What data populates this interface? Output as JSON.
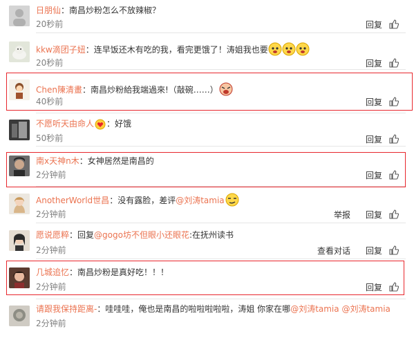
{
  "comments": [
    {
      "user": "日朋仙",
      "sep": "：",
      "text": "南昌炒粉怎么不放辣椒？",
      "time": "20秒前",
      "reply": "回复"
    },
    {
      "user": "kkw滴团子妞",
      "sep": "：",
      "text": "连早饭还木有吃的我，看完更饿了！涛姐我也要",
      "time": "20秒前",
      "reply": "回复"
    },
    {
      "user": "Chen陳清畫",
      "sep": "：",
      "text": "南昌炒粉給我端過來!（敲碗……）",
      "time": "40秒前",
      "reply": "回复"
    },
    {
      "user": "不愿听天由命人",
      "sep": "：",
      "text": "好饿",
      "time": "50秒前",
      "reply": "回复"
    },
    {
      "user": "南x天神n木",
      "sep": "：",
      "text": "女神居然是南昌的",
      "time": "2分钟前",
      "reply": "回复"
    },
    {
      "user": "AnotherWorld世昌",
      "sep": "：",
      "text": "没有露脸，差评",
      "mention": "@刘涛tamia",
      "time": "2分钟前",
      "report": "举报",
      "reply": "回复"
    },
    {
      "user": "愿说愿粹",
      "sep": "：",
      "text_pre": "回复",
      "mention": "@gogo坊不但眼小还眼花",
      "text": ":在抚州读书",
      "time": "2分钟前",
      "view_conv": "查看对话",
      "reply": "回复"
    },
    {
      "user": "几城追忆",
      "sep": "：",
      "text": "南昌炒粉是真好吃！！！",
      "time": "2分钟前",
      "reply": "回复"
    },
    {
      "user": "请跟我保持距离-",
      "sep": "：",
      "text": "哇哇哇，俺也是南昌的啦啦啦啦啦，涛姐 你家在哪",
      "mention": "@刘涛tamia",
      "mention2": "@刘涛tamia",
      "time": "2分钟前"
    }
  ],
  "icons": {
    "like": "thumbs-up-icon",
    "emoji": "cartoon-face-icon"
  },
  "colors": {
    "username": "#eb7350",
    "highlight": "#e8252b",
    "time": "#808080"
  }
}
